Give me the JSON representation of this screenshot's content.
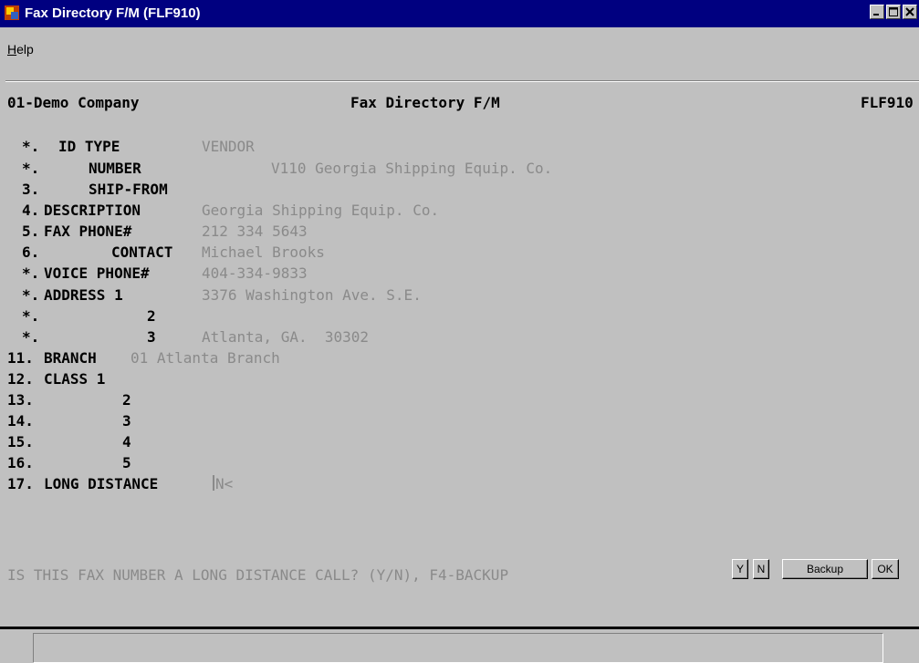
{
  "window": {
    "title": "Fax Directory F/M (FLF910)"
  },
  "menu": {
    "help": "Help"
  },
  "header": {
    "company": "01-Demo Company",
    "screen_title": "Fax Directory F/M",
    "program_id": "FLF910"
  },
  "fields": [
    {
      "num": "*.",
      "label": "ID TYPE",
      "value": "VENDOR"
    },
    {
      "num": "*.",
      "label": "NUMBER",
      "value": "V110 Georgia Shipping Equip. Co."
    },
    {
      "num": "3.",
      "label": "SHIP-FROM",
      "value": ""
    },
    {
      "num": "4.",
      "label": "DESCRIPTION",
      "value": "Georgia Shipping Equip. Co."
    },
    {
      "num": "5.",
      "label": "FAX PHONE#",
      "value": "212 334 5643"
    },
    {
      "num": "6.",
      "label": "CONTACT",
      "value": "Michael Brooks"
    },
    {
      "num": "*.",
      "label": "VOICE PHONE#",
      "value": "404-334-9833"
    },
    {
      "num": "*.",
      "label": "ADDRESS 1",
      "value": "3376 Washington Ave. S.E."
    },
    {
      "num": "*.",
      "label": "2",
      "value": ""
    },
    {
      "num": "*.",
      "label": "3",
      "value": "Atlanta, GA.  30302"
    },
    {
      "num": "11.",
      "label": "BRANCH",
      "value": "01 Atlanta Branch"
    },
    {
      "num": "12.",
      "label": "CLASS 1",
      "value": ""
    },
    {
      "num": "13.",
      "label": "2",
      "value": ""
    },
    {
      "num": "14.",
      "label": "3",
      "value": ""
    },
    {
      "num": "15.",
      "label": "4",
      "value": ""
    },
    {
      "num": "16.",
      "label": "5",
      "value": ""
    },
    {
      "num": "17.",
      "label": "LONG DISTANCE",
      "value": "N<"
    }
  ],
  "prompt": "IS THIS FAX NUMBER A LONG DISTANCE CALL? (Y/N), F4-BACKUP",
  "buttons": {
    "yes": "Y",
    "no": "N",
    "backup": "Backup",
    "ok": "OK"
  }
}
